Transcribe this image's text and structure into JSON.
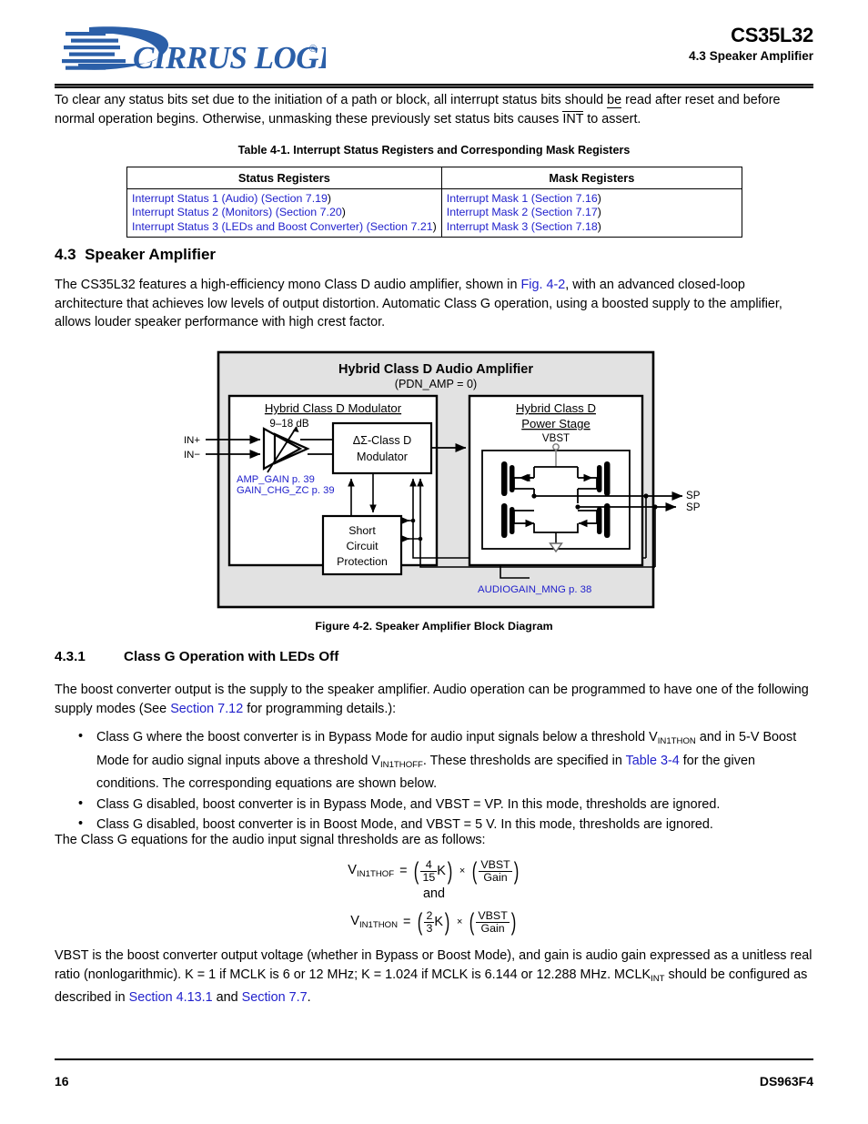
{
  "header": {
    "logo_text": "CIRRUS LOGIC",
    "logo_reg": "®",
    "part_number": "CS35L32",
    "section_title": "4.3 Speaker Amplifier",
    "logo_color": "#2b5fa8"
  },
  "intro_paragraph": {
    "line1_a": "To clear any status bits set due to the initiation of a path or block, all interrupt status bits should ",
    "line1_be": "be",
    "line1_b": " read after reset and before normal operation begins. Otherwise, unmasking these previously set status bits causes ",
    "int_label": "INT",
    "line1_c": " to assert."
  },
  "table": {
    "caption": "Table 4-1.  Interrupt Status Registers and Corresponding Mask Registers",
    "headers": [
      "Status Registers",
      "Mask Registers"
    ],
    "rows": [
      {
        "status_name": "Interrupt Status 1 (Audio) ",
        "status_paren_open": "(",
        "status_section": "Section 7.19",
        "status_paren_close": ")",
        "mask_name": "Interrupt Mask 1 ",
        "mask_paren_open": "(",
        "mask_section": "Section 7.16",
        "mask_paren_close": ")"
      },
      {
        "status_name": "Interrupt Status 2 (Monitors) ",
        "status_paren_open": "(",
        "status_section": "Section 7.20",
        "status_paren_close": ")",
        "mask_name": "Interrupt Mask 2 ",
        "mask_paren_open": "(",
        "mask_section": "Section 7.17",
        "mask_paren_close": ")"
      },
      {
        "status_name": "Interrupt Status 3 (LEDs and Boost Converter) ",
        "status_paren_open": "(",
        "status_section": "Section 7.21",
        "status_paren_close": ")",
        "mask_name": "Interrupt Mask 3 ",
        "mask_paren_open": "(",
        "mask_section": "Section 7.18",
        "mask_paren_close": ")"
      }
    ]
  },
  "section_43": {
    "number": "4.3",
    "title": "Speaker Amplifier",
    "para_a": "The CS35L32 features a high-efficiency mono Class D audio amplifier, shown in ",
    "para_link": "Fig. 4-2",
    "para_b": ", with an advanced closed-loop architecture that achieves low levels of output distortion. Automatic Class G operation, using a boosted supply to the amplifier, allows louder speaker performance with high crest factor."
  },
  "figure": {
    "caption": "Figure 4-2. Speaker Amplifier Block Diagram",
    "outer_title": "Hybrid Class D Audio Amplifier",
    "outer_subtitle": "(PDN_AMP = 0)",
    "modulator_block_title": "Hybrid Class D Modulator",
    "gain_range": "9–18 dB",
    "modulator_label_line1": "ΔΣ-Class D",
    "modulator_label_line2": "Modulator",
    "scp_line1": "Short",
    "scp_line2": "Circuit",
    "scp_line3": "Protection",
    "power_stage_title_line1": "Hybrid Class D",
    "power_stage_title_line2": "Power Stage",
    "vbst_label": "VBST",
    "input_plus": "IN+",
    "input_minus": "IN−",
    "output_plus": "SPKOUT+",
    "output_minus": "SPKOUT−",
    "reg_amp_gain": "AMP_GAIN p. 39",
    "reg_gain_chg_zc": "GAIN_CHG_ZC p. 39",
    "reg_audiogain_mng": "AUDIOGAIN_MNG p. 38",
    "link_color": "#2222cc",
    "panel_fill": "#e2e2e2"
  },
  "section_431": {
    "number": "4.3.1",
    "title": "Class G Operation with LEDs Off",
    "para_a": "The boost converter output is the supply to the speaker amplifier. Audio operation can be programmed to have one of the following supply modes (See ",
    "para_link": "Section 7.12",
    "para_b": " for programming details.):"
  },
  "bullets": [
    {
      "marker": "•",
      "a": "Class G where the boost converter is in Bypass Mode for audio input signals below a threshold V",
      "sub1": "IN1THON",
      "b": " and in 5-V Boost Mode for audio signal inputs above a threshold V",
      "sub2": "IN1THOFF",
      "c": ". These thresholds are specified in ",
      "link": "Table 3-4",
      "d": " for the given conditions. The corresponding equations are shown below."
    },
    {
      "marker": "•",
      "a": "Class G disabled, boost converter is in Bypass Mode, and VBST = VP. In this mode, thresholds are ignored.",
      "sub1": "",
      "b": "",
      "sub2": "",
      "c": "",
      "link": "",
      "d": ""
    },
    {
      "marker": "•",
      "a": "Class G disabled, boost converter is in Boost Mode, and VBST = 5 V. In this mode, thresholds are ignored.",
      "sub1": "",
      "b": "",
      "sub2": "",
      "c": "",
      "link": "",
      "d": ""
    }
  ],
  "equations_intro": "The Class G equations for the audio input signal thresholds are as follows:",
  "equations": {
    "eq1": {
      "lhs_v": "V",
      "lhs_sub": "IN1THOF",
      "equals": "=",
      "num1": "4",
      "den1": "15",
      "k": "K",
      "times": "×",
      "num2": "VBST",
      "den2": "Gain"
    },
    "and_label": "and",
    "eq2": {
      "lhs_v": "V",
      "lhs_sub": "IN1THON",
      "equals": "=",
      "num1": "2",
      "den1": "3",
      "k": "K",
      "times": "×",
      "num2": "VBST",
      "den2": "Gain"
    }
  },
  "closing_paragraph": {
    "a": "VBST is the boost converter output voltage (whether in Bypass or Boost Mode), and gain is audio gain expressed as a unitless real ratio (nonlogarithmic). K = 1 if MCLK is 6 or 12 MHz; K = 1.024 if MCLK is 6.144 or 12.288 MHz. MCLK",
    "sub": "INT",
    "b": " should be configured as described in ",
    "link1": "Section 4.13.1",
    "mid": " and ",
    "link2": "Section 7.7",
    "c": "."
  },
  "footer": {
    "page_number": "16",
    "doc_number": "DS963F4"
  }
}
